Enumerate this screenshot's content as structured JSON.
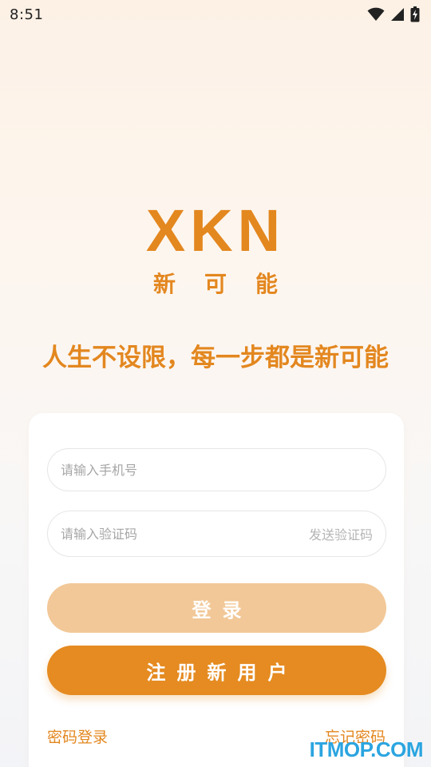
{
  "status_bar": {
    "time": "8:51",
    "icons": [
      "wifi-icon",
      "signal-icon",
      "battery-charging-icon"
    ]
  },
  "brand": {
    "logo": "XKN",
    "name_cn": "新可能",
    "slogan": "人生不设限，每一步都是新可能"
  },
  "form": {
    "phone_placeholder": "请输入手机号",
    "code_placeholder": "请输入验证码",
    "send_code_label": "发送验证码",
    "login_label": "登录",
    "register_label": "注册新用户",
    "password_login_label": "密码登录",
    "forgot_password_label": "忘记密码"
  },
  "watermark": "ITMOP.COM",
  "colors": {
    "accent": "#e3871f",
    "login_button": "#f2c898",
    "register_button": "#e58b21",
    "watermark": "#2ba5e0"
  }
}
